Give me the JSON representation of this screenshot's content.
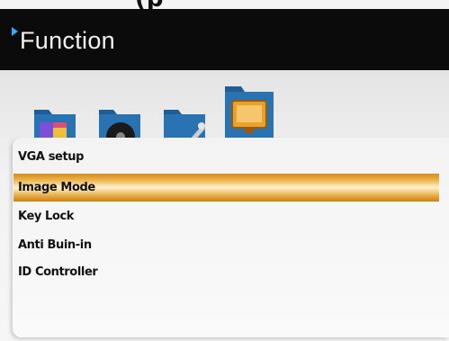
{
  "header": {
    "top_caption": "(p",
    "title": "Function"
  },
  "icons": [
    {
      "name": "picture-folder-icon",
      "color": "#1d5e96"
    },
    {
      "name": "disc-folder-icon",
      "color": "#1d5e96"
    },
    {
      "name": "tools-folder-icon",
      "color": "#1d5e96"
    },
    {
      "name": "monitor-folder-icon",
      "color": "#e8a12a"
    }
  ],
  "menu": {
    "items": [
      {
        "label": "VGA setup",
        "selected": false
      },
      {
        "label": "Image Mode",
        "selected": true
      },
      {
        "label": "Key Lock",
        "selected": false
      },
      {
        "label": "Anti Buin-in",
        "selected": false
      },
      {
        "label": "ID Controller",
        "selected": false
      }
    ]
  },
  "colors": {
    "header_bg": "#0b0b0b",
    "header_arrow": "#33aaff",
    "highlight": "#eab24a",
    "folder_blue": "#1d5e96"
  }
}
